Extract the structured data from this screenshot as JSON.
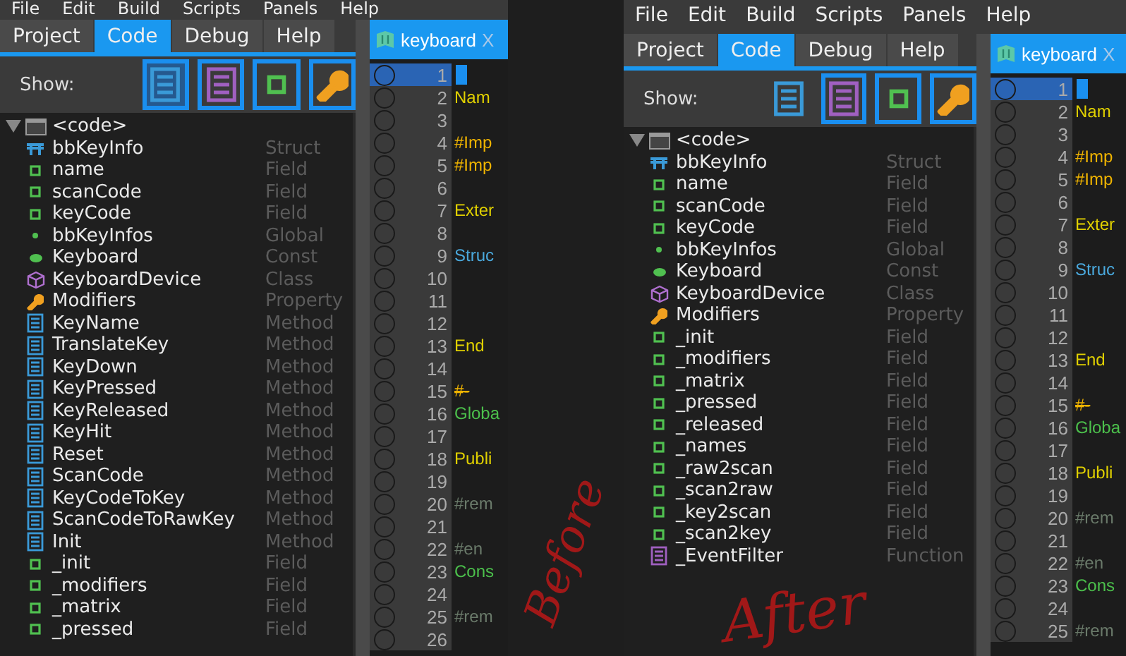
{
  "screens": [
    {
      "annotation": "Before",
      "menu": [
        "File",
        "Edit",
        "Build",
        "Scripts",
        "Panels",
        "Help"
      ],
      "panel_tabs": [
        {
          "label": "Project",
          "selected": false
        },
        {
          "label": "Code",
          "selected": true
        },
        {
          "label": "Debug",
          "selected": false
        },
        {
          "label": "Help",
          "selected": false
        }
      ],
      "show_label": "Show:",
      "filters": [
        {
          "kind": "method",
          "on": true,
          "hovered": true
        },
        {
          "kind": "function",
          "on": true,
          "hovered": false
        },
        {
          "kind": "field",
          "on": true,
          "hovered": false
        },
        {
          "kind": "property",
          "on": true,
          "hovered": false
        }
      ],
      "tree": {
        "label": "<code>",
        "expanded": true,
        "children": [
          {
            "name": "bbKeyInfo",
            "type": "Struct",
            "kind": "struct"
          },
          {
            "name": "name",
            "type": "Field",
            "kind": "field"
          },
          {
            "name": "scanCode",
            "type": "Field",
            "kind": "field"
          },
          {
            "name": "keyCode",
            "type": "Field",
            "kind": "field"
          },
          {
            "name": "bbKeyInfos",
            "type": "Global",
            "kind": "global"
          },
          {
            "name": "Keyboard",
            "type": "Const",
            "kind": "const"
          },
          {
            "name": "KeyboardDevice",
            "type": "Class",
            "kind": "class"
          },
          {
            "name": "Modifiers",
            "type": "Property",
            "kind": "property"
          },
          {
            "name": "KeyName",
            "type": "Method",
            "kind": "method"
          },
          {
            "name": "TranslateKey",
            "type": "Method",
            "kind": "method"
          },
          {
            "name": "KeyDown",
            "type": "Method",
            "kind": "method"
          },
          {
            "name": "KeyPressed",
            "type": "Method",
            "kind": "method"
          },
          {
            "name": "KeyReleased",
            "type": "Method",
            "kind": "method"
          },
          {
            "name": "KeyHit",
            "type": "Method",
            "kind": "method"
          },
          {
            "name": "Reset",
            "type": "Method",
            "kind": "method"
          },
          {
            "name": "ScanCode",
            "type": "Method",
            "kind": "method"
          },
          {
            "name": "KeyCodeToKey",
            "type": "Method",
            "kind": "method"
          },
          {
            "name": "ScanCodeToRawKey",
            "type": "Method",
            "kind": "method"
          },
          {
            "name": "Init",
            "type": "Method",
            "kind": "method"
          },
          {
            "name": "_init",
            "type": "Field",
            "kind": "field"
          },
          {
            "name": "_modifiers",
            "type": "Field",
            "kind": "field"
          },
          {
            "name": "_matrix",
            "type": "Field",
            "kind": "field"
          },
          {
            "name": "_pressed",
            "type": "Field",
            "kind": "field"
          }
        ]
      },
      "editor": {
        "tab": "keyboard",
        "close": "X",
        "lines": [
          {
            "number": "1",
            "selected": true
          },
          {
            "number": "2",
            "selected": false,
            "kind": "keyword",
            "text": "Nam"
          },
          {
            "number": "3",
            "selected": false
          },
          {
            "number": "4",
            "selected": false,
            "kind": "directive",
            "text": "#Imp"
          },
          {
            "number": "5",
            "selected": false,
            "kind": "directive",
            "text": "#Imp"
          },
          {
            "number": "6",
            "selected": false
          },
          {
            "number": "7",
            "selected": false,
            "kind": "keyword",
            "text": "Exter"
          },
          {
            "number": "8",
            "selected": false
          },
          {
            "number": "9",
            "selected": false,
            "kind": "type",
            "text": "Struc"
          },
          {
            "number": "10",
            "selected": false
          },
          {
            "number": "11",
            "selected": false
          },
          {
            "number": "12",
            "selected": false
          },
          {
            "number": "13",
            "selected": false,
            "kind": "keyword",
            "text": "End"
          },
          {
            "number": "14",
            "selected": false
          },
          {
            "number": "15",
            "selected": false,
            "kind": "separator",
            "text": "#-"
          },
          {
            "number": "16",
            "selected": false,
            "kind": "global",
            "text": "Globa"
          },
          {
            "number": "17",
            "selected": false
          },
          {
            "number": "18",
            "selected": false,
            "kind": "keyword",
            "text": "Publi"
          },
          {
            "number": "19",
            "selected": false
          },
          {
            "number": "20",
            "selected": false,
            "kind": "comment",
            "text": "#rem"
          },
          {
            "number": "21",
            "selected": false
          },
          {
            "number": "22",
            "selected": false,
            "kind": "comment",
            "text": "#en"
          },
          {
            "number": "23",
            "selected": false,
            "kind": "global",
            "text": "Cons"
          },
          {
            "number": "24",
            "selected": false
          },
          {
            "number": "25",
            "selected": false,
            "kind": "comment",
            "text": "#rem"
          },
          {
            "number": "26",
            "selected": false
          }
        ]
      }
    },
    {
      "annotation": "After",
      "menu": [
        "File",
        "Edit",
        "Build",
        "Scripts",
        "Panels",
        "Help"
      ],
      "panel_tabs": [
        {
          "label": "Project",
          "selected": false
        },
        {
          "label": "Code",
          "selected": true
        },
        {
          "label": "Debug",
          "selected": false
        },
        {
          "label": "Help",
          "selected": false
        }
      ],
      "show_label": "Show:",
      "filters": [
        {
          "kind": "method",
          "on": false,
          "hovered": false
        },
        {
          "kind": "function",
          "on": true,
          "hovered": false
        },
        {
          "kind": "field",
          "on": true,
          "hovered": false
        },
        {
          "kind": "property",
          "on": true,
          "hovered": false
        }
      ],
      "tree": {
        "label": "<code>",
        "expanded": true,
        "children": [
          {
            "name": "bbKeyInfo",
            "type": "Struct",
            "kind": "struct"
          },
          {
            "name": "name",
            "type": "Field",
            "kind": "field"
          },
          {
            "name": "scanCode",
            "type": "Field",
            "kind": "field"
          },
          {
            "name": "keyCode",
            "type": "Field",
            "kind": "field"
          },
          {
            "name": "bbKeyInfos",
            "type": "Global",
            "kind": "global"
          },
          {
            "name": "Keyboard",
            "type": "Const",
            "kind": "const"
          },
          {
            "name": "KeyboardDevice",
            "type": "Class",
            "kind": "class"
          },
          {
            "name": "Modifiers",
            "type": "Property",
            "kind": "property"
          },
          {
            "name": "_init",
            "type": "Field",
            "kind": "field"
          },
          {
            "name": "_modifiers",
            "type": "Field",
            "kind": "field"
          },
          {
            "name": "_matrix",
            "type": "Field",
            "kind": "field"
          },
          {
            "name": "_pressed",
            "type": "Field",
            "kind": "field"
          },
          {
            "name": "_released",
            "type": "Field",
            "kind": "field"
          },
          {
            "name": "_names",
            "type": "Field",
            "kind": "field"
          },
          {
            "name": "_raw2scan",
            "type": "Field",
            "kind": "field"
          },
          {
            "name": "_scan2raw",
            "type": "Field",
            "kind": "field"
          },
          {
            "name": "_key2scan",
            "type": "Field",
            "kind": "field"
          },
          {
            "name": "_scan2key",
            "type": "Field",
            "kind": "field"
          },
          {
            "name": "_EventFilter",
            "type": "Function",
            "kind": "function"
          }
        ]
      },
      "editor": {
        "tab": "keyboard",
        "close": "X",
        "lines": [
          {
            "number": "1",
            "selected": true
          },
          {
            "number": "2",
            "selected": false,
            "kind": "keyword",
            "text": "Nam"
          },
          {
            "number": "3",
            "selected": false
          },
          {
            "number": "4",
            "selected": false,
            "kind": "directive",
            "text": "#Imp"
          },
          {
            "number": "5",
            "selected": false,
            "kind": "directive",
            "text": "#Imp"
          },
          {
            "number": "6",
            "selected": false
          },
          {
            "number": "7",
            "selected": false,
            "kind": "keyword",
            "text": "Exter"
          },
          {
            "number": "8",
            "selected": false
          },
          {
            "number": "9",
            "selected": false,
            "kind": "type",
            "text": "Struc"
          },
          {
            "number": "10",
            "selected": false
          },
          {
            "number": "11",
            "selected": false
          },
          {
            "number": "12",
            "selected": false
          },
          {
            "number": "13",
            "selected": false,
            "kind": "keyword",
            "text": "End"
          },
          {
            "number": "14",
            "selected": false
          },
          {
            "number": "15",
            "selected": false,
            "kind": "separator",
            "text": "#-"
          },
          {
            "number": "16",
            "selected": false,
            "kind": "global",
            "text": "Globa"
          },
          {
            "number": "17",
            "selected": false
          },
          {
            "number": "18",
            "selected": false,
            "kind": "keyword",
            "text": "Publi"
          },
          {
            "number": "19",
            "selected": false
          },
          {
            "number": "20",
            "selected": false,
            "kind": "comment",
            "text": "#rem"
          },
          {
            "number": "21",
            "selected": false
          },
          {
            "number": "22",
            "selected": false,
            "kind": "comment",
            "text": "#en"
          },
          {
            "number": "23",
            "selected": false,
            "kind": "global",
            "text": "Cons"
          },
          {
            "number": "24",
            "selected": false
          },
          {
            "number": "25",
            "selected": false,
            "kind": "comment",
            "text": "#rem"
          }
        ]
      }
    }
  ]
}
